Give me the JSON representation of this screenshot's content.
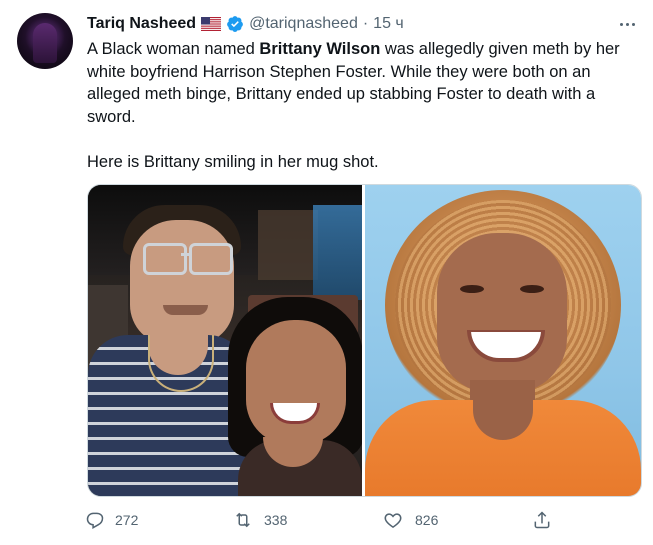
{
  "tweet": {
    "author_name": "Tariq Nasheed",
    "handle": "@tariqnasheed",
    "separator": "·",
    "time": "15 ч",
    "text_segments": [
      "A Black woman named ",
      "Brittany Wilson",
      " was allegedly given meth by her white boyfriend Harrison Stephen Foster. While they were both on an alleged meth binge, Brittany ended up stabbing Foster to death with a sword."
    ],
    "text_second": "Here is Brittany smiling in her mug shot."
  },
  "actions": {
    "replies": "272",
    "retweets": "338",
    "likes": "826"
  },
  "icons": {
    "flag": "us-flag-icon",
    "verified": "verified-badge-icon",
    "more": "more-icon",
    "reply": "reply-icon",
    "retweet": "retweet-icon",
    "like": "like-icon",
    "share": "share-icon"
  },
  "colors": {
    "verified": "#1d9bf0",
    "text": "#0f1419",
    "secondary": "#536471"
  }
}
